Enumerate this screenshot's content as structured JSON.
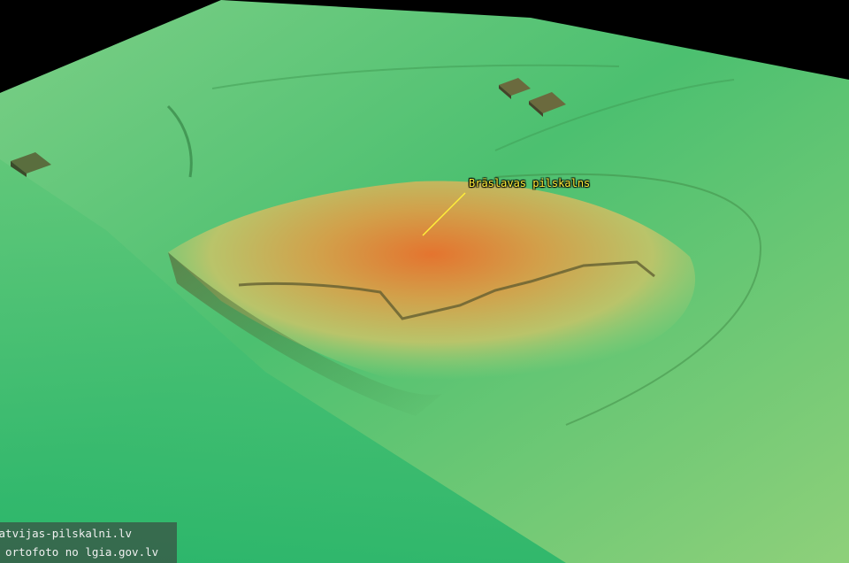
{
  "map": {
    "annotation_label": "Brāslavas pilskalns"
  },
  "credits": {
    "line1": "latvijas-pilskalni.lv",
    "line2": "n ortofoto no lgia.gov.lv"
  },
  "colors": {
    "sky": "#000000",
    "terrain_low": "#2fb86a",
    "terrain_mid": "#a9d27a",
    "terrain_high": "#e0803a",
    "label": "#ffef3a"
  }
}
